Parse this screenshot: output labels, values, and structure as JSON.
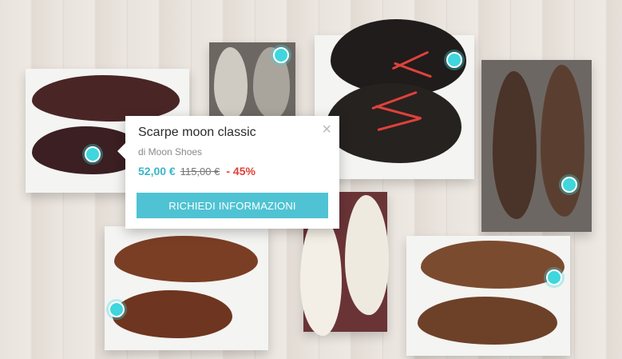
{
  "popup": {
    "title": "Scarpe moon classic",
    "brand": "di Moon Shoes",
    "price": "52,00 €",
    "old_price": "115,00 €",
    "discount": "- 45%",
    "close_icon": "×",
    "cta_label": "RICHIEDI INFORMAZIONI"
  },
  "colors": {
    "hotspot": "#3fd6de",
    "cta": "#4fc3d3",
    "price": "#3bb6c7",
    "discount": "#e0413b"
  }
}
